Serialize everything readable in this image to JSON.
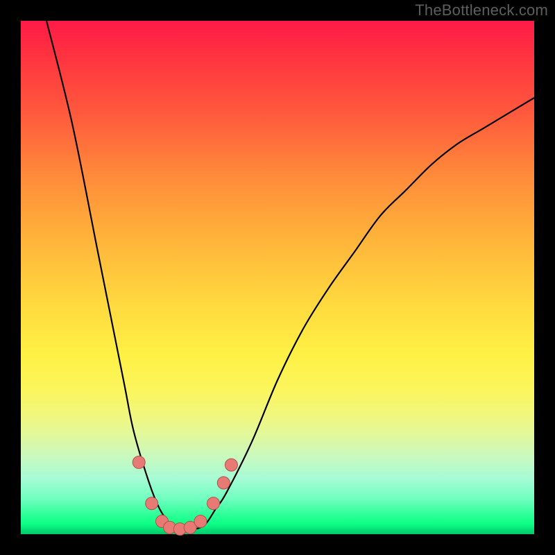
{
  "watermark": "TheBottleneck.com",
  "colors": {
    "frame": "#000000",
    "curve": "#000000",
    "marker_fill": "#e77a74",
    "marker_stroke": "#b44f49"
  },
  "chart_data": {
    "type": "line",
    "title": "",
    "xlabel": "",
    "ylabel": "",
    "xlim": [
      0,
      100
    ],
    "ylim": [
      0,
      100
    ],
    "grid": false,
    "series": [
      {
        "name": "bottleneck-curve",
        "x": [
          5,
          10,
          15,
          20,
          22,
          25,
          27,
          29,
          30,
          32,
          34,
          36,
          38,
          40,
          45,
          50,
          55,
          60,
          65,
          70,
          75,
          80,
          85,
          90,
          95,
          100
        ],
        "y": [
          100,
          80,
          55,
          30,
          20,
          10,
          5,
          2,
          1,
          1,
          1,
          2,
          5,
          8,
          18,
          30,
          40,
          48,
          55,
          62,
          67,
          72,
          76,
          79,
          82,
          85
        ]
      }
    ],
    "markers": [
      {
        "x": 23.0,
        "y": 14.0
      },
      {
        "x": 25.5,
        "y": 6.0
      },
      {
        "x": 27.5,
        "y": 2.5
      },
      {
        "x": 29.0,
        "y": 1.3
      },
      {
        "x": 31.0,
        "y": 1.0
      },
      {
        "x": 33.0,
        "y": 1.3
      },
      {
        "x": 35.0,
        "y": 2.5
      },
      {
        "x": 37.5,
        "y": 6.0
      },
      {
        "x": 39.5,
        "y": 10.0
      },
      {
        "x": 41.0,
        "y": 13.5
      }
    ]
  }
}
